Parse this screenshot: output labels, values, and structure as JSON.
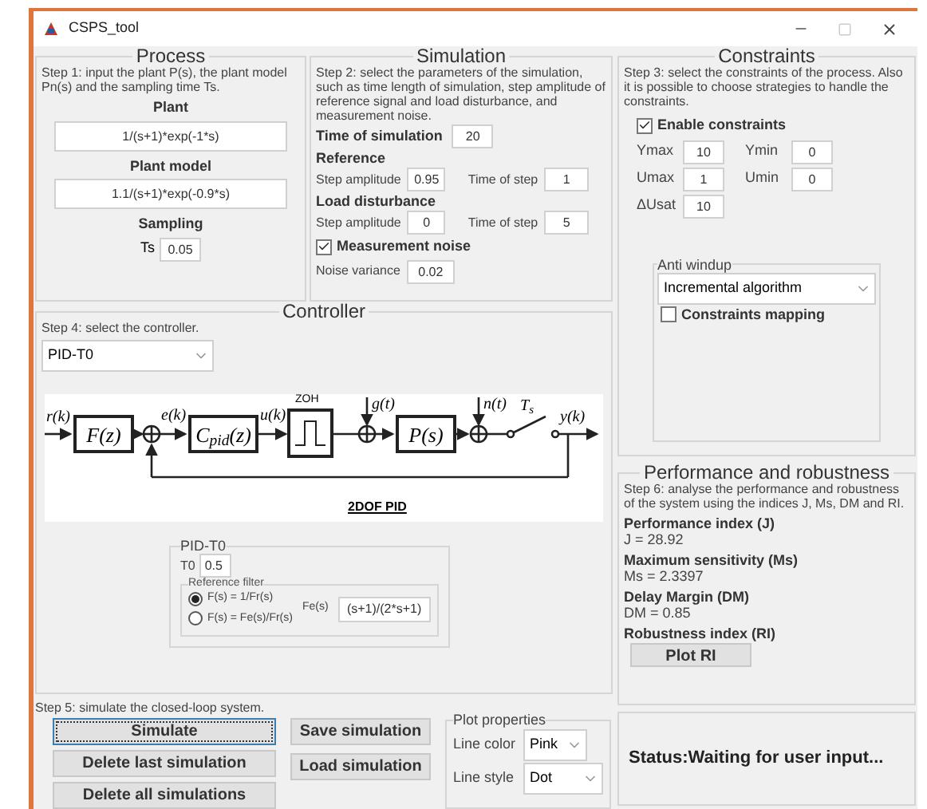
{
  "window": {
    "title": "CSPS_tool"
  },
  "process": {
    "title": "Process",
    "instructions": "Step 1: input the plant P(s), the plant model Pn(s) and the sampling time Ts.",
    "plant": {
      "label": "Plant",
      "value": "1/(s+1)*exp(-1*s)"
    },
    "plant_model": {
      "label": "Plant model",
      "value": "1.1/(s+1)*exp(-0.9*s)"
    },
    "sampling": {
      "label": "Sampling",
      "field_label": "Ts",
      "value": "0.05"
    }
  },
  "simulation": {
    "title": "Simulation",
    "instructions": "Step 2: select the parameters of the simulation, such as time length of simulation, step amplitude of reference  signal and load disturbance, and measurement noise.",
    "time": {
      "label": "Time of simulation",
      "value": "20"
    },
    "reference": {
      "label": "Reference",
      "amplitude_label": "Step amplitude",
      "amplitude": "0.95",
      "time_label": "Time of step",
      "time": "1"
    },
    "load_disturbance": {
      "label": "Load disturbance",
      "amplitude_label": "Step amplitude",
      "amplitude": "0",
      "time_label": "Time of step",
      "time": "5"
    },
    "noise": {
      "label": "Measurement noise",
      "checked": true,
      "variance_label": "Noise variance",
      "variance": "0.02"
    }
  },
  "constraints": {
    "title": "Constraints",
    "instructions": "Step 3: select the constraints of the process. Also it is possible to choose strategies to handle the constraints.",
    "enable": {
      "label": "Enable constraints",
      "checked": true
    },
    "fields": [
      {
        "label": "Ymax",
        "value": "10"
      },
      {
        "label": "Ymin",
        "value": "0"
      },
      {
        "label": "Umax",
        "value": "1"
      },
      {
        "label": "Umin",
        "value": "0"
      },
      {
        "label": "ΔUsat",
        "value": "10"
      }
    ],
    "anti_windup": {
      "title": "Anti windup",
      "value": "Incremental algorithm"
    },
    "mapping": {
      "label": "Constraints mapping",
      "checked": false
    }
  },
  "controller": {
    "title": "Controller",
    "instructions": "Step 4: select the controller.",
    "value": "PID-T0",
    "diagram": {
      "input": "r(k)",
      "filter": "F(z)",
      "error": "e(k)",
      "controller": "C$_{pid}$(z)",
      "control": "u(k)",
      "hold": "ZOH",
      "disturbance": "g(t)",
      "plant": "P(s)",
      "noise": "n(t)",
      "sampler": "T$_{s}$",
      "output": "y(k)",
      "caption": "2DOF PID"
    },
    "settings": {
      "title": "PID-T0",
      "t0_label": "T0",
      "t0": "0.5",
      "filter_title": "Reference filter",
      "options": [
        {
          "label": "F(s) = 1/Fr(s)",
          "selected": true
        },
        {
          "label": "F(s) = Fe(s)/Fr(s)",
          "selected": false
        }
      ],
      "fe_label": "Fe(s)",
      "fe": "(s+1)/(2*s+1)"
    }
  },
  "run": {
    "instructions": "Step 5: simulate the closed-loop system.",
    "left_buttons": [
      {
        "label": "Simulate",
        "focused": true
      },
      {
        "label": "Delete last simulation",
        "focused": false
      },
      {
        "label": "Delete all simulations",
        "focused": false
      }
    ],
    "right_buttons": [
      {
        "label": "Save simulation",
        "focused": false
      },
      {
        "label": "Load simulation",
        "focused": false
      }
    ]
  },
  "plot_properties": {
    "title": "Plot properties",
    "line_color": {
      "label": "Line color",
      "value": "Pink"
    },
    "line_style": {
      "label": "Line style",
      "value": "Dot"
    }
  },
  "performance": {
    "title": "Performance and robustness",
    "instructions": "Step 6: analyse the performance and robustness of the system using the indices J, Ms, DM and RI.",
    "indices": [
      {
        "label": "Performance index (J)",
        "value": "J =  28.92"
      },
      {
        "label": "Maximum sensitivity (Ms)",
        "value": "Ms = 2.3397"
      },
      {
        "label": "Delay Margin (DM)",
        "value": "DM =  0.85"
      }
    ],
    "robustness": {
      "label": "Robustness index (RI)",
      "button": "Plot RI"
    }
  },
  "status": "Status:Waiting for user input..."
}
